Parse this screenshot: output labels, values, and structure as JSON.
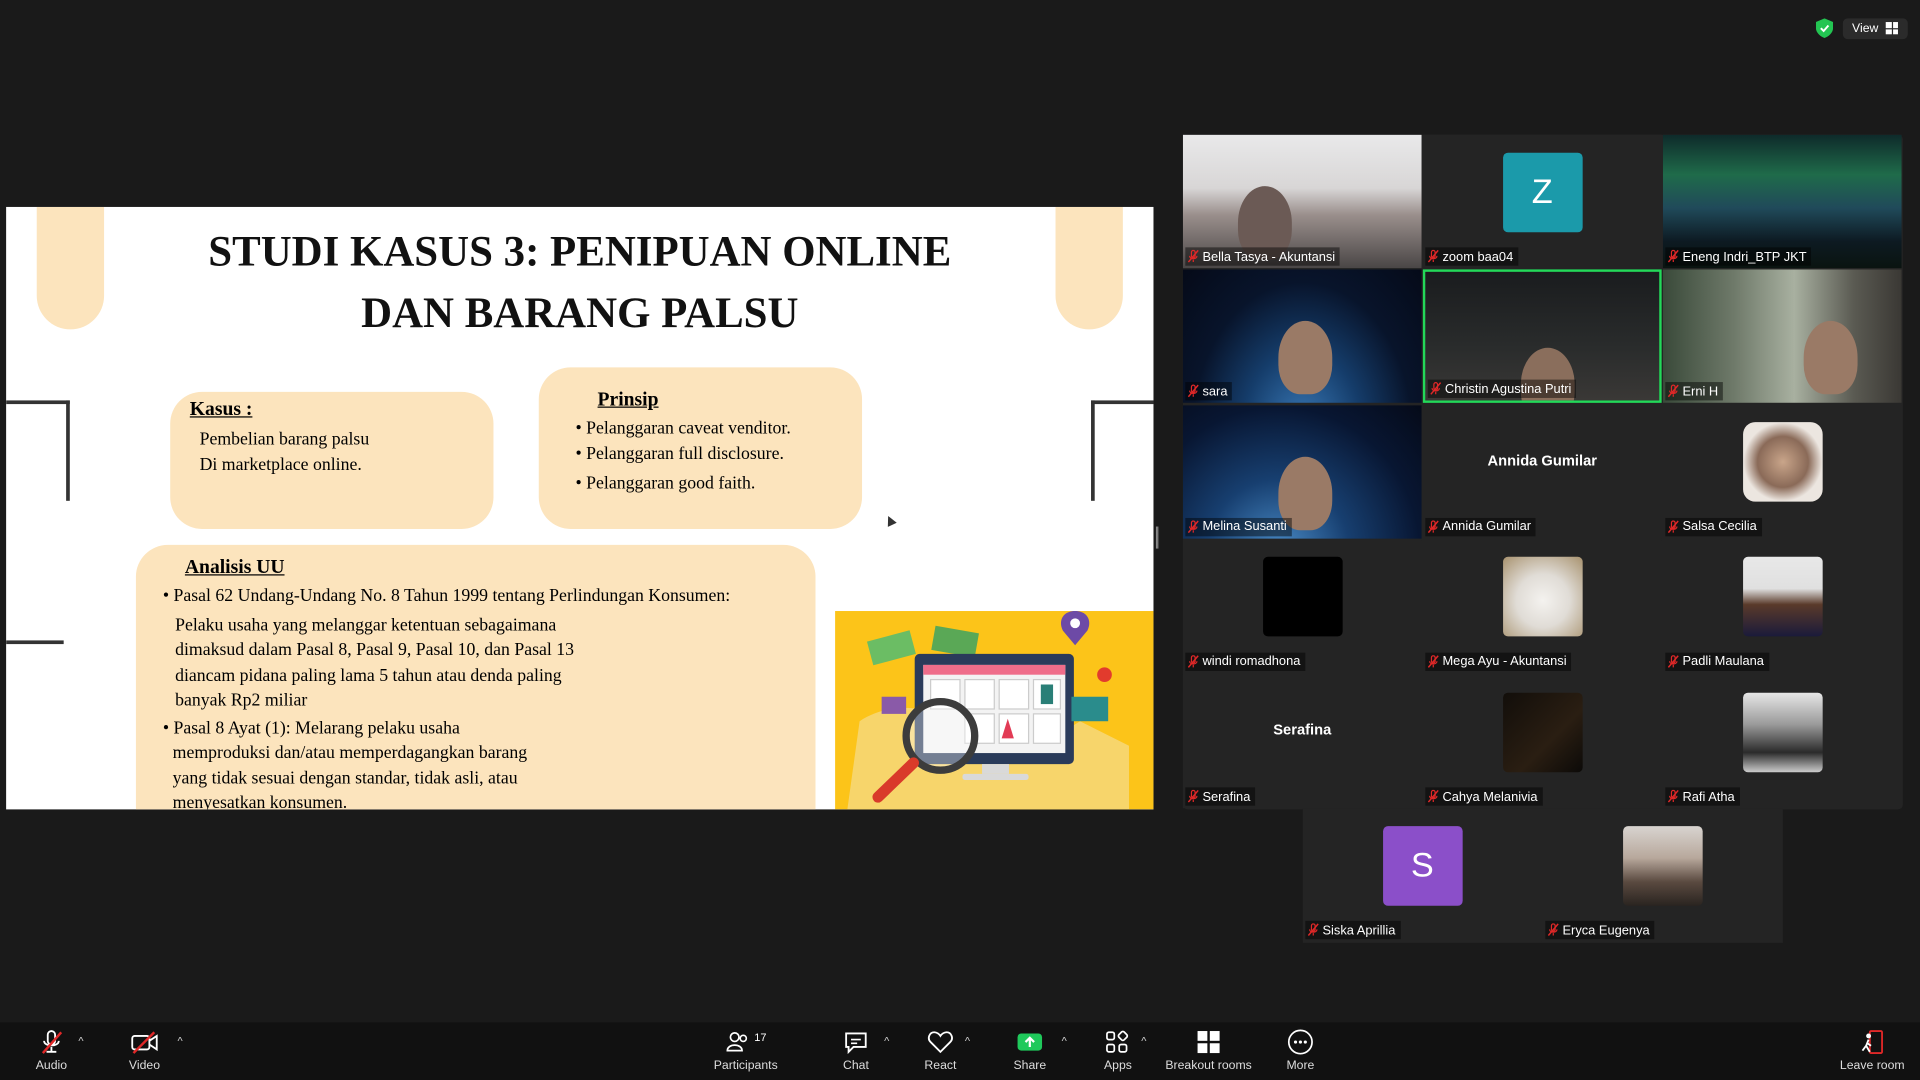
{
  "window": {
    "view_label": "View"
  },
  "slide": {
    "title_line1": "STUDI KASUS 3: PENIPUAN ONLINE",
    "title_line2": "DAN BARANG PALSU",
    "kasus": {
      "heading": "Kasus :",
      "lines": [
        "Pembelian barang palsu",
        "Di marketplace online."
      ]
    },
    "prinsip": {
      "heading": "Prinsip",
      "bullets": [
        "Pelanggaran caveat venditor.",
        "Pelanggaran full disclosure.",
        "Pelanggaran good faith."
      ]
    },
    "analisis": {
      "heading": "Analisis UU",
      "bullet1": "Pasal 62 Undang-Undang No. 8 Tahun 1999 tentang Perlindungan Konsumen:",
      "bullet1_body": [
        "Pelaku usaha yang melanggar ketentuan sebagaimana",
        "dimaksud dalam Pasal 8, Pasal 9, Pasal 10, dan Pasal 13",
        "diancam pidana paling lama 5 tahun atau denda paling",
        "banyak Rp2 miliar"
      ],
      "bullet2": "Pasal 8 Ayat (1): Melarang pelaku usaha",
      "bullet2_body": [
        "memproduksi dan/atau memperdagangkan barang",
        "yang tidak sesuai dengan standar, tidak asli, atau",
        "menyesatkan konsumen."
      ]
    }
  },
  "participants": [
    {
      "name": "Bella Tasya - Akuntansi",
      "kind": "video-hijab"
    },
    {
      "name": "zoom baa04",
      "kind": "letter",
      "letter": "Z",
      "color": "#1b9aaa"
    },
    {
      "name": "Eneng Indri_BTP JKT",
      "kind": "video-aurora"
    },
    {
      "name": "sara",
      "kind": "video-earth"
    },
    {
      "name": "Christin Agustina Putri",
      "kind": "video-dark",
      "speaker": true
    },
    {
      "name": "Erni H",
      "kind": "video-room"
    },
    {
      "name": "Melina Susanti",
      "kind": "video-earth2"
    },
    {
      "name": "Annida Gumilar",
      "kind": "name-only",
      "display": "Annida Gumilar"
    },
    {
      "name": "Salsa Cecilia",
      "kind": "photo-round"
    },
    {
      "name": "windi romadhona",
      "kind": "photo-black"
    },
    {
      "name": "Mega Ayu - Akuntansi",
      "kind": "photo-cat"
    },
    {
      "name": "Padli Maulana",
      "kind": "photo-man"
    },
    {
      "name": "Serafina",
      "kind": "name-only",
      "display": "Serafina"
    },
    {
      "name": "Cahya Melanivia",
      "kind": "photo-dark"
    },
    {
      "name": "Rafi Atha",
      "kind": "photo-bw"
    },
    {
      "name": "Siska Aprillia",
      "kind": "letter",
      "letter": "S",
      "color": "#8b4fc9"
    },
    {
      "name": "Eryca Eugenya",
      "kind": "photo-girl"
    }
  ],
  "toolbar": {
    "audio": "Audio",
    "video": "Video",
    "participants": "Participants",
    "participants_count": "17",
    "chat": "Chat",
    "react": "React",
    "share": "Share",
    "apps": "Apps",
    "breakout": "Breakout rooms",
    "more": "More",
    "leave": "Leave room"
  },
  "colors": {
    "accent_green": "#23d959",
    "slide_box": "#fce4bd",
    "share_green": "#1fc95b",
    "mute_red": "#e02828"
  }
}
